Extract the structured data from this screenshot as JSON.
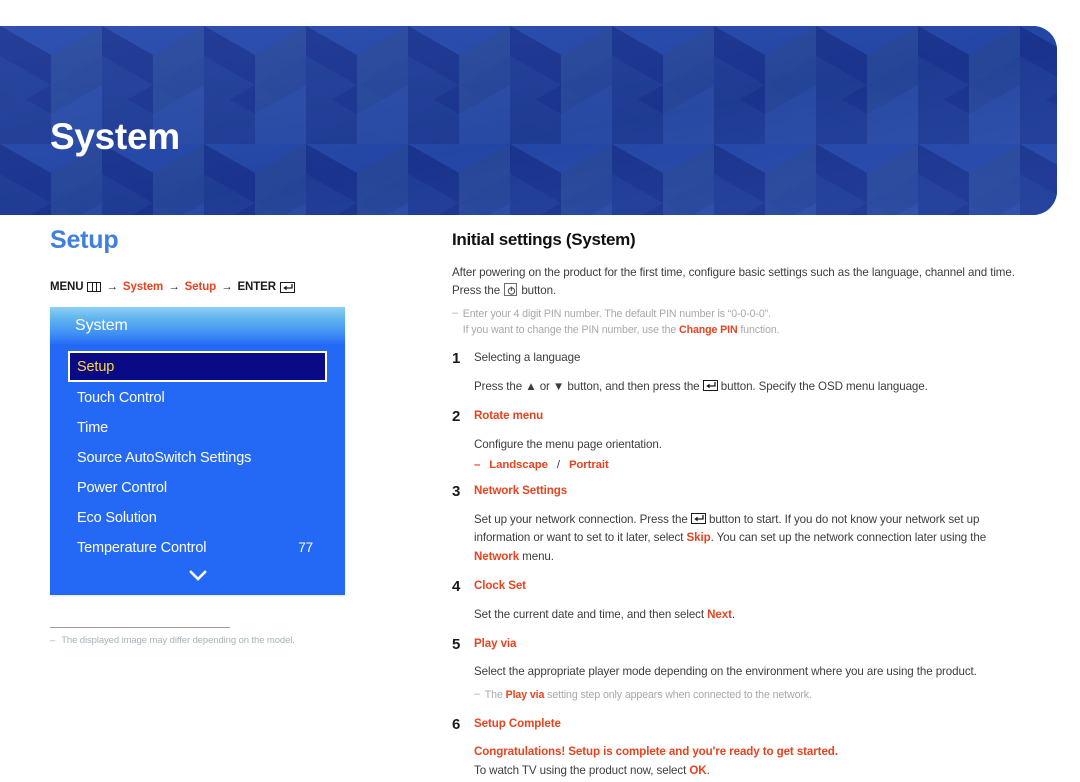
{
  "banner": {
    "title": "System",
    "bg_color": "#1f3fa0",
    "pattern": "isometric-cubes"
  },
  "left": {
    "section_title": "Setup",
    "breadcrumb": {
      "menu_label": "MENU",
      "menu_icon": "menu-grid-icon",
      "arrow": "→",
      "item1": "System",
      "item2": "Setup",
      "enter_label": "ENTER",
      "enter_icon": "enter-return-icon"
    },
    "osd": {
      "header": "System",
      "items": [
        {
          "label": "Setup",
          "value": "",
          "selected": true
        },
        {
          "label": "Touch Control",
          "value": "",
          "selected": false
        },
        {
          "label": "Time",
          "value": "",
          "selected": false
        },
        {
          "label": "Source AutoSwitch Settings",
          "value": "",
          "selected": false
        },
        {
          "label": "Power Control",
          "value": "",
          "selected": false
        },
        {
          "label": "Eco Solution",
          "value": "",
          "selected": false
        },
        {
          "label": "Temperature Control",
          "value": "77",
          "selected": false
        }
      ],
      "scroll_icon": "chevron-down-icon",
      "selected_bg": "#0a0a86",
      "selected_text": "#ffd83a",
      "panel_bg": "#2468f6"
    },
    "footnote": {
      "dash": "–",
      "text": "The displayed image may differ depending on the model."
    }
  },
  "right": {
    "title": "Initial settings (System)",
    "intro_line1": "After powering on the product for the first time, configure basic settings such as the language, channel and time.",
    "intro_line2_pre": "Press the",
    "intro_line2_icon": "power-button-icon",
    "intro_line2_post": "button.",
    "pin_note": {
      "dash": "–",
      "line1": "Enter your 4 digit PIN number. The default PIN number is “0-0-0-0”.",
      "line2_pre": "If you want to change the PIN number, use the",
      "line2_bold": "Change PIN",
      "line2_post": "function."
    },
    "steps": [
      {
        "num": "1",
        "head": "Selecting a language",
        "head_red": false,
        "detail_pre": "Press the ▲ or ▼ button, and then press the",
        "detail_icon": "enter-return-icon",
        "detail_post": "button. Specify the OSD menu language."
      },
      {
        "num": "2",
        "head": "Rotate menu",
        "head_red": true,
        "detail": "Configure the menu page orientation.",
        "sub": {
          "dash": "–",
          "opt1": "Landscape",
          "sep": "/",
          "opt2": "Portrait"
        }
      },
      {
        "num": "3",
        "head": "Network Settings",
        "head_red": true,
        "detail_pre": "Set up your network connection. Press the",
        "detail_icon": "enter-return-icon",
        "detail_mid": "button to start. If you do not know your network set up information or want to set to it later, select",
        "detail_red1": "Skip",
        "detail_mid2": ". You can set up the network connection later using the",
        "detail_red2": "Network",
        "detail_post": "menu."
      },
      {
        "num": "4",
        "head": "Clock Set",
        "head_red": true,
        "detail_pre": "Set the current date and time, and then select",
        "detail_red1": "Next",
        "detail_post": "."
      },
      {
        "num": "5",
        "head": "Play via",
        "head_red": true,
        "detail": "Select the appropriate player mode depending on the environment where you are using the product.",
        "note": {
          "dash": "–",
          "pre": "The",
          "bold": "Play via",
          "post": "setting step only appears when connected to the network."
        }
      },
      {
        "num": "6",
        "head": "Setup Complete",
        "head_red": true,
        "detail_red": "Congratulations! Setup is complete and you're ready to get started.",
        "detail_pre": "To watch TV using the product now, select",
        "detail_red1": "OK",
        "detail_post": "."
      }
    ]
  }
}
